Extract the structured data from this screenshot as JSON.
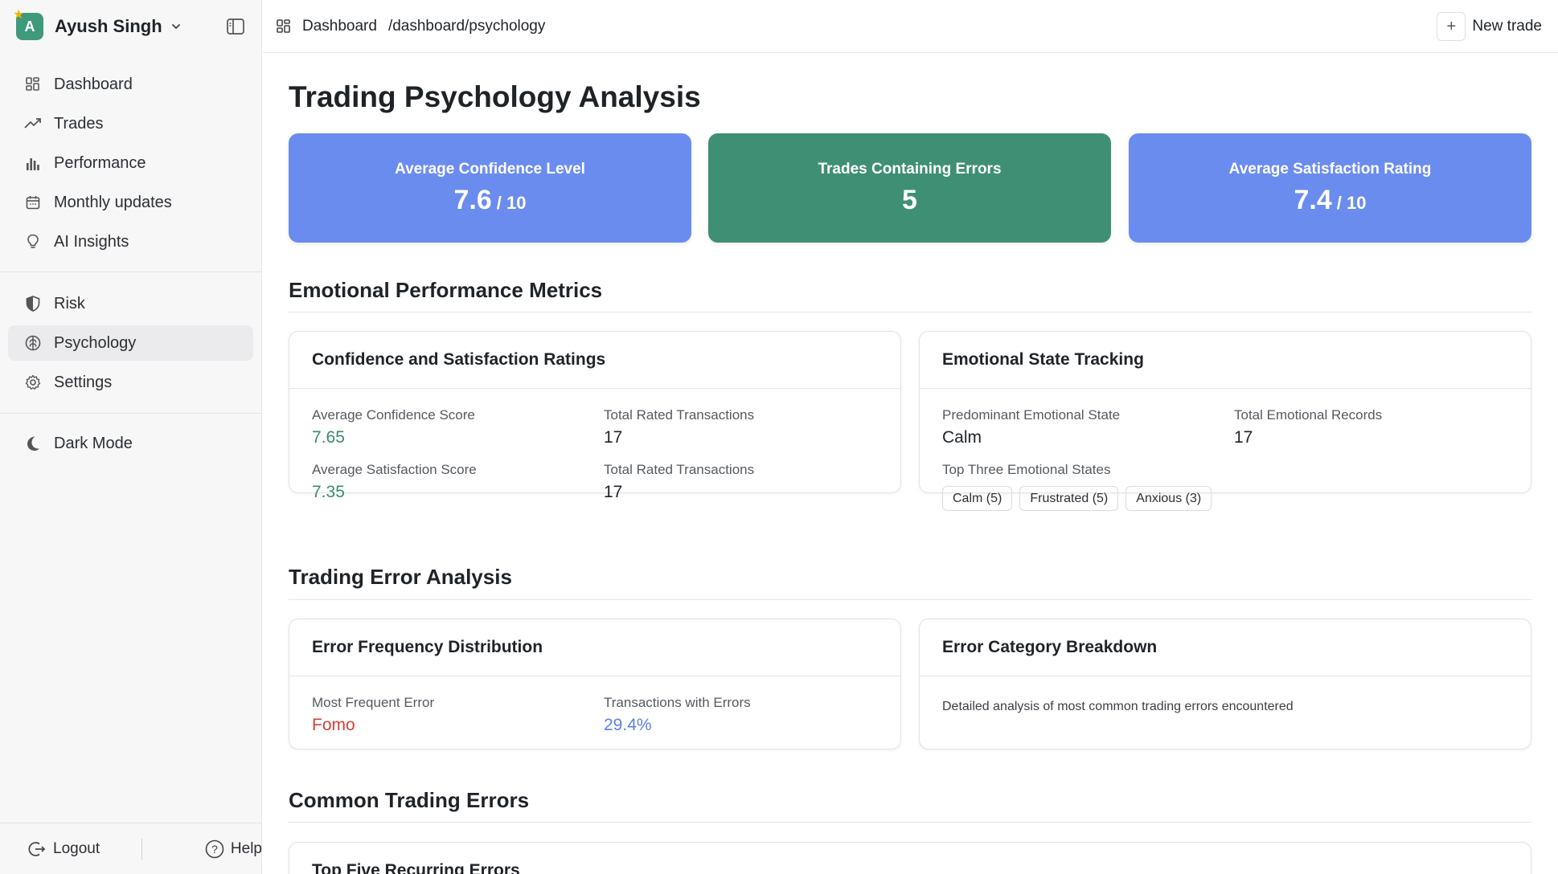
{
  "user": {
    "initial": "A",
    "name": "Ayush Singh"
  },
  "sidebar": {
    "items": [
      {
        "label": "Dashboard",
        "icon": "grid-icon"
      },
      {
        "label": "Trades",
        "icon": "trend-up-icon"
      },
      {
        "label": "Performance",
        "icon": "bar-chart-icon"
      },
      {
        "label": "Monthly updates",
        "icon": "calendar-icon"
      },
      {
        "label": "AI Insights",
        "icon": "lightbulb-icon"
      }
    ],
    "items2": [
      {
        "label": "Risk",
        "icon": "shield-icon"
      },
      {
        "label": "Psychology",
        "icon": "brain-icon",
        "active": true
      },
      {
        "label": "Settings",
        "icon": "gear-icon"
      }
    ],
    "dark_mode": "Dark Mode",
    "logout": "Logout",
    "help": "Help"
  },
  "topbar": {
    "crumb": "Dashboard",
    "path": "/dashboard/psychology",
    "new_trade": "New trade"
  },
  "page": {
    "title": "Trading Psychology Analysis",
    "stats": [
      {
        "label": "Average Confidence Level",
        "value": "7.6",
        "unit": "/ 10",
        "color": "#6b8cef"
      },
      {
        "label": "Trades Containing Errors",
        "value": "5",
        "unit": "",
        "color": "#3f8f74"
      },
      {
        "label": "Average Satisfaction Rating",
        "value": "7.4",
        "unit": "/ 10",
        "color": "#6b8cef"
      }
    ],
    "emotional_section": "Emotional Performance Metrics",
    "confidence_panel": {
      "title": "Confidence and Satisfaction Ratings",
      "avg_conf_label": "Average Confidence Score",
      "avg_conf_value": "7.65",
      "total_rated_label_1": "Total Rated Transactions",
      "total_rated_value_1": "17",
      "avg_sat_label": "Average Satisfaction Score",
      "avg_sat_value": "7.35",
      "total_rated_label_2": "Total Rated Transactions",
      "total_rated_value_2": "17"
    },
    "emotion_panel": {
      "title": "Emotional State Tracking",
      "predominant_label": "Predominant Emotional State",
      "predominant_value": "Calm",
      "records_label": "Total Emotional Records",
      "records_value": "17",
      "top_three_label": "Top Three Emotional States",
      "chips": [
        "Calm (5)",
        "Frustrated (5)",
        "Anxious (3)"
      ]
    },
    "error_section": "Trading Error Analysis",
    "freq_panel": {
      "title": "Error Frequency Distribution",
      "most_label": "Most Frequent Error",
      "most_value": "Fomo",
      "tx_label": "Transactions with Errors",
      "tx_value": "29.4%"
    },
    "category_panel": {
      "title": "Error Category Breakdown",
      "desc": "Detailed analysis of most common trading errors encountered"
    },
    "common_section": "Common Trading Errors",
    "top_five_panel": {
      "title": "Top Five Recurring Errors"
    }
  }
}
